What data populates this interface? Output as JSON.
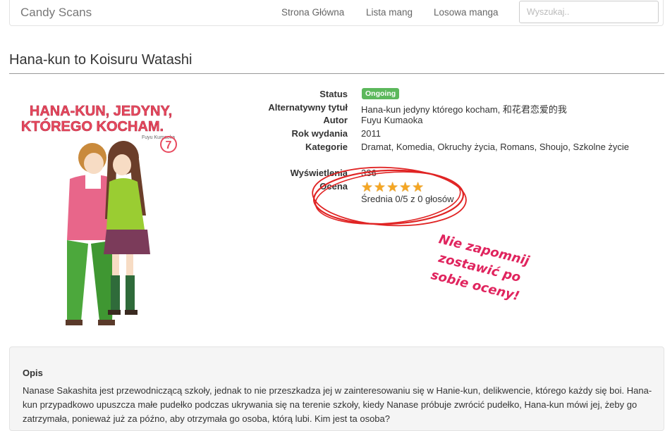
{
  "navbar": {
    "brand": "Candy Scans",
    "links": [
      "Strona Główna",
      "Lista mang",
      "Losowa manga"
    ],
    "search_placeholder": "Wyszukaj.."
  },
  "manga": {
    "title": "Hana-kun to Koisuru Watashi",
    "cover": {
      "title_line1": "HANA-KUN, JEDYNY,",
      "title_line2": "KTÓREGO KOCHAM.",
      "author": "Fuyu Kumaoka",
      "volume": "7"
    },
    "details": {
      "status_label": "Status",
      "status_value": "Ongoing",
      "alt_title_label": "Alternatywny tytuł",
      "alt_title_value": "Hana-kun jedyny którego kocham, 和花君恋爱的我",
      "author_label": "Autor",
      "author_value": "Fuyu Kumaoka",
      "year_label": "Rok wydania",
      "year_value": "2011",
      "categories_label": "Kategorie",
      "categories_value": "Dramat, Komedia, Okruchy życia, Romans, Shoujo, Szkolne życie",
      "views_label": "Wyświetlenia",
      "views_value": "336",
      "rating_label": "Ocena",
      "rating_stars": "★★★★★",
      "rating_summary": "Średnia 0/5 z 0 głosów"
    }
  },
  "annotation": {
    "note_lines": [
      "Nie zapomnij",
      "zostawić po",
      "sobie oceny!"
    ],
    "color": "#e0245e"
  },
  "description": {
    "heading": "Opis",
    "text": "Nanase Sakashita jest przewodniczącą szkoły, jednak to nie przeszkadza jej w zainteresowaniu się w Hanie-kun, delikwencie, którego każdy się boi. Hana-kun przypadkowo upuszcza małe pudełko podczas ukrywania się na terenie szkoły, kiedy Nanase próbuje zwrócić pudełko, Hana-kun mówi jej, żeby go zatrzymała, ponieważ już za późno, aby otrzymała go osoba, którą lubi. Kim jest ta osoba?"
  },
  "colors": {
    "badge": "#5cb85c",
    "stars": "#f5a623",
    "annotation": "#e0245e"
  }
}
